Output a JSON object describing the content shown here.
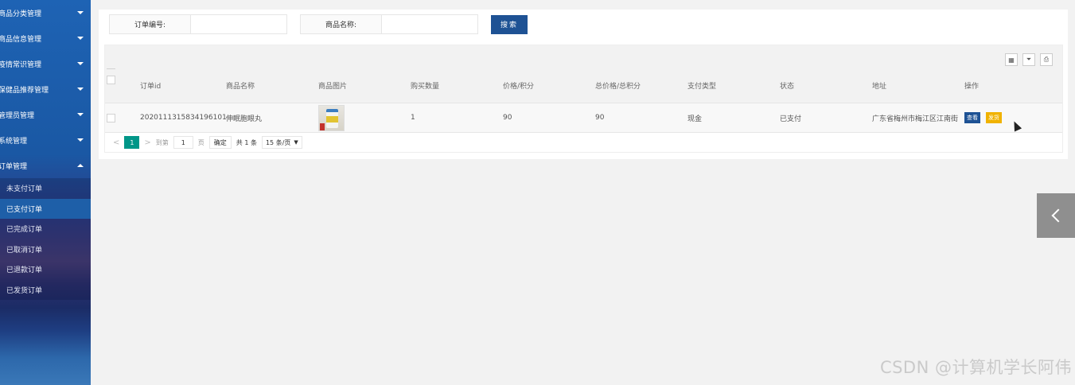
{
  "sidebar": {
    "menu": [
      {
        "label": "商品分类管理",
        "expanded": false
      },
      {
        "label": "商品信息管理",
        "expanded": false
      },
      {
        "label": "疫情常识管理",
        "expanded": false
      },
      {
        "label": "保健品推荐管理",
        "expanded": false
      },
      {
        "label": "管理员管理",
        "expanded": false
      },
      {
        "label": "系统管理",
        "expanded": false
      },
      {
        "label": "订单管理",
        "expanded": true
      }
    ],
    "submenu": [
      {
        "label": "未支付订单",
        "active": false
      },
      {
        "label": "已支付订单",
        "active": true
      },
      {
        "label": "已完成订单",
        "active": false
      },
      {
        "label": "已取消订单",
        "active": false
      },
      {
        "label": "已退款订单",
        "active": false
      },
      {
        "label": "已发货订单",
        "active": false
      }
    ]
  },
  "search": {
    "order_no_label": "订单编号:",
    "order_no_value": "",
    "product_name_label": "商品名称:",
    "product_name_value": "",
    "button_label": "搜索"
  },
  "toolbar": {
    "icons": [
      "columns-icon",
      "export-icon",
      "print-icon"
    ]
  },
  "table": {
    "headers": {
      "id": "订单id",
      "name": "商品名称",
      "image": "商品图片",
      "qty": "购买数量",
      "price": "价格/积分",
      "total": "总价格/总积分",
      "pay_type": "支付类型",
      "status": "状态",
      "address": "地址",
      "ops": "操作"
    },
    "rows": [
      {
        "id": "20201113158341961017​1",
        "name": "伸眠胞眼丸",
        "qty": "1",
        "price": "90",
        "total": "90",
        "pay_type": "现金",
        "status": "已支付",
        "address": "广东省梅州市梅江区江南街",
        "view_label": "查看",
        "ship_label": "发货"
      }
    ]
  },
  "pager": {
    "prev": "<",
    "current": "1",
    "next": ">",
    "goto_label": "到第",
    "goto_value": "1",
    "page_unit": "页",
    "confirm_label": "确定",
    "total_label": "共 1 条",
    "page_size": "15 条/页"
  },
  "watermark": "CSDN @计算机学长阿伟",
  "colors": {
    "primary": "#1e5294",
    "ship": "#f0b200",
    "pager_active": "#009688"
  }
}
